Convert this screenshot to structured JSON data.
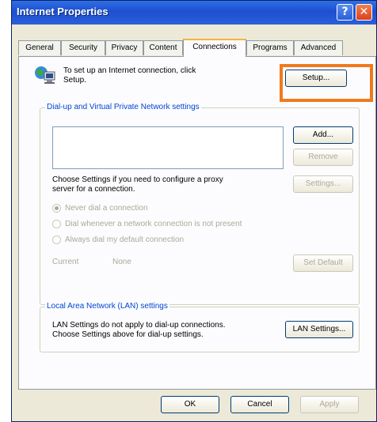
{
  "window": {
    "title": "Internet Properties",
    "help_glyph": "?",
    "close_glyph": "✕"
  },
  "tabs": [
    {
      "label": "General"
    },
    {
      "label": "Security"
    },
    {
      "label": "Privacy"
    },
    {
      "label": "Content"
    },
    {
      "label": "Connections",
      "active": true
    },
    {
      "label": "Programs"
    },
    {
      "label": "Advanced"
    }
  ],
  "setup": {
    "text_line1": "To set up an Internet connection, click",
    "text_line2": "Setup.",
    "button": "Setup..."
  },
  "dialup": {
    "legend": "Dial-up and Virtual Private Network settings",
    "add_button": "Add...",
    "remove_button": "Remove",
    "proxy_text_line1": "Choose Settings if you need to configure a proxy",
    "proxy_text_line2": "server for a connection.",
    "settings_button": "Settings...",
    "radios": [
      {
        "label": "Never dial a connection",
        "selected": true
      },
      {
        "label": "Dial whenever a network connection is not present",
        "selected": false
      },
      {
        "label": "Always dial my default connection",
        "selected": false
      }
    ],
    "current_label": "Current",
    "current_value": "None",
    "set_default_button": "Set Default"
  },
  "lan": {
    "legend": "Local Area Network (LAN) settings",
    "text_line1": "LAN Settings do not apply to dial-up connections.",
    "text_line2": "Choose Settings above for dial-up settings.",
    "button": "LAN Settings..."
  },
  "footer": {
    "ok": "OK",
    "cancel": "Cancel",
    "apply": "Apply"
  },
  "colors": {
    "highlight": "#f07a1e",
    "titlebar": "#2060d8",
    "legend": "#0046d5"
  }
}
